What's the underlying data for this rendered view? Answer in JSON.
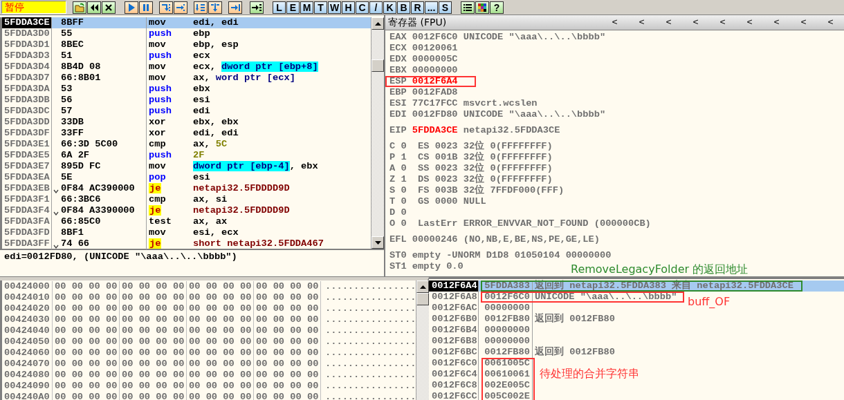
{
  "toolbar": {
    "status": "暂停",
    "letters": [
      "L",
      "E",
      "M",
      "T",
      "W",
      "H",
      "C",
      "/",
      "K",
      "B",
      "R",
      "...",
      "S"
    ],
    "help": "?"
  },
  "disassembly": {
    "rows": [
      {
        "address": "5FDDA3CE",
        "jump_mark": false,
        "bytes": "8BFF",
        "mnemonic": "mov",
        "kind": "plain",
        "selected": true,
        "operands": [
          {
            "text": "edi, edi",
            "kind": "reg"
          }
        ]
      },
      {
        "address": "5FDDA3D0",
        "jump_mark": false,
        "bytes": "55",
        "mnemonic": "push",
        "kind": "stack",
        "selected": false,
        "operands": [
          {
            "text": "ebp",
            "kind": "reg"
          }
        ]
      },
      {
        "address": "5FDDA3D1",
        "jump_mark": false,
        "bytes": "8BEC",
        "mnemonic": "mov",
        "kind": "plain",
        "selected": false,
        "operands": [
          {
            "text": "ebp, esp",
            "kind": "reg"
          }
        ]
      },
      {
        "address": "5FDDA3D3",
        "jump_mark": false,
        "bytes": "51",
        "mnemonic": "push",
        "kind": "stack",
        "selected": false,
        "operands": [
          {
            "text": "ecx",
            "kind": "reg"
          }
        ]
      },
      {
        "address": "5FDDA3D4",
        "jump_mark": false,
        "bytes": "8B4D 08",
        "mnemonic": "mov",
        "kind": "plain",
        "selected": false,
        "operands": [
          {
            "text": "ecx, ",
            "kind": "reg"
          },
          {
            "text": "dword ptr [ebp+8]",
            "kind": "memhl"
          }
        ]
      },
      {
        "address": "5FDDA3D7",
        "jump_mark": false,
        "bytes": "66:8B01",
        "mnemonic": "mov",
        "kind": "plain",
        "selected": false,
        "operands": [
          {
            "text": "ax, ",
            "kind": "reg"
          },
          {
            "text": "word ptr [ecx]",
            "kind": "mem"
          }
        ]
      },
      {
        "address": "5FDDA3DA",
        "jump_mark": false,
        "bytes": "53",
        "mnemonic": "push",
        "kind": "stack",
        "selected": false,
        "operands": [
          {
            "text": "ebx",
            "kind": "reg"
          }
        ]
      },
      {
        "address": "5FDDA3DB",
        "jump_mark": false,
        "bytes": "56",
        "mnemonic": "push",
        "kind": "stack",
        "selected": false,
        "operands": [
          {
            "text": "esi",
            "kind": "reg"
          }
        ]
      },
      {
        "address": "5FDDA3DC",
        "jump_mark": false,
        "bytes": "57",
        "mnemonic": "push",
        "kind": "stack",
        "selected": false,
        "operands": [
          {
            "text": "edi",
            "kind": "reg"
          }
        ]
      },
      {
        "address": "5FDDA3DD",
        "jump_mark": false,
        "bytes": "33DB",
        "mnemonic": "xor",
        "kind": "plain",
        "selected": false,
        "operands": [
          {
            "text": "ebx, ebx",
            "kind": "reg"
          }
        ]
      },
      {
        "address": "5FDDA3DF",
        "jump_mark": false,
        "bytes": "33FF",
        "mnemonic": "xor",
        "kind": "plain",
        "selected": false,
        "operands": [
          {
            "text": "edi, edi",
            "kind": "reg"
          }
        ]
      },
      {
        "address": "5FDDA3E1",
        "jump_mark": false,
        "bytes": "66:3D 5C00",
        "mnemonic": "cmp",
        "kind": "plain",
        "selected": false,
        "operands": [
          {
            "text": "ax, ",
            "kind": "reg"
          },
          {
            "text": "5C",
            "kind": "const"
          }
        ]
      },
      {
        "address": "5FDDA3E5",
        "jump_mark": false,
        "bytes": "6A 2F",
        "mnemonic": "push",
        "kind": "stack",
        "selected": false,
        "operands": [
          {
            "text": "2F",
            "kind": "const"
          }
        ]
      },
      {
        "address": "5FDDA3E7",
        "jump_mark": false,
        "bytes": "895D FC",
        "mnemonic": "mov",
        "kind": "plain",
        "selected": false,
        "operands": [
          {
            "text": "dword ptr [ebp-4]",
            "kind": "memhl"
          },
          {
            "text": ", ebx",
            "kind": "reg"
          }
        ]
      },
      {
        "address": "5FDDA3EA",
        "jump_mark": false,
        "bytes": "5E",
        "mnemonic": "pop",
        "kind": "stack",
        "selected": false,
        "operands": [
          {
            "text": "esi",
            "kind": "reg"
          }
        ]
      },
      {
        "address": "5FDDA3EB",
        "jump_mark": true,
        "bytes": "0F84 AC390000",
        "mnemonic": "je",
        "kind": "jump",
        "selected": false,
        "operands": [
          {
            "text": "netapi32.5FDDDD9D",
            "kind": "target"
          }
        ]
      },
      {
        "address": "5FDDA3F1",
        "jump_mark": false,
        "bytes": "66:3BC6",
        "mnemonic": "cmp",
        "kind": "plain",
        "selected": false,
        "operands": [
          {
            "text": "ax, si",
            "kind": "reg"
          }
        ]
      },
      {
        "address": "5FDDA3F4",
        "jump_mark": true,
        "bytes": "0F84 A3390000",
        "mnemonic": "je",
        "kind": "jump",
        "selected": false,
        "operands": [
          {
            "text": "netapi32.5FDDDD9D",
            "kind": "target"
          }
        ]
      },
      {
        "address": "5FDDA3FA",
        "jump_mark": false,
        "bytes": "66:85C0",
        "mnemonic": "test",
        "kind": "plain",
        "selected": false,
        "operands": [
          {
            "text": "ax, ax",
            "kind": "reg"
          }
        ]
      },
      {
        "address": "5FDDA3FD",
        "jump_mark": false,
        "bytes": "8BF1",
        "mnemonic": "mov",
        "kind": "plain",
        "selected": false,
        "operands": [
          {
            "text": "esi, ecx",
            "kind": "reg"
          }
        ]
      },
      {
        "address": "5FDDA3FF",
        "jump_mark": true,
        "bytes": "74 66",
        "mnemonic": "je",
        "kind": "jump",
        "selected": false,
        "operands": [
          {
            "text": "short netapi32.5FDDA467",
            "kind": "target"
          }
        ]
      }
    ],
    "info": "edi=0012FD80, (UNICODE \"\\aaa\\..\\..\\bbbb\")"
  },
  "registers": {
    "title": "寄存器 (FPU)",
    "arrows": [
      "<",
      "<",
      "<",
      "<",
      "<",
      "<",
      "<",
      "<",
      "<"
    ],
    "groups": [
      [
        {
          "kind": "reg",
          "name": "EAX",
          "value": "0012F6C0",
          "comment": "UNICODE \"\\aaa\\..\\..\\bbbb\"",
          "changed": false
        },
        {
          "kind": "reg",
          "name": "ECX",
          "value": "00120061",
          "changed": false
        },
        {
          "kind": "reg",
          "name": "EDX",
          "value": "0000005C",
          "changed": false
        },
        {
          "kind": "reg",
          "name": "EBX",
          "value": "00000000",
          "changed": false
        },
        {
          "kind": "reg",
          "name": "ESP",
          "value": "0012F6A4",
          "changed": true,
          "box": {
            "color": "#ff3333"
          }
        },
        {
          "kind": "reg",
          "name": "EBP",
          "value": "0012FAD8",
          "changed": false
        },
        {
          "kind": "reg",
          "name": "ESI",
          "value": "77C17FCC",
          "comment": "msvcrt.wcslen",
          "changed": false
        },
        {
          "kind": "reg",
          "name": "EDI",
          "value": "0012FD80",
          "comment": "UNICODE \"\\aaa\\..\\..\\bbbb\"",
          "changed": false
        }
      ],
      [
        {
          "kind": "reg",
          "name": "EIP",
          "value": "5FDDA3CE",
          "comment": "netapi32.5FDDA3CE",
          "changed": true
        }
      ],
      [
        {
          "kind": "text",
          "text": "C 0  ES 0023 32位 0(FFFFFFFF)"
        },
        {
          "kind": "text",
          "text": "P 1  CS 001B 32位 0(FFFFFFFF)"
        },
        {
          "kind": "text",
          "text": "A 0  SS 0023 32位 0(FFFFFFFF)"
        },
        {
          "kind": "text",
          "text": "Z 1  DS 0023 32位 0(FFFFFFFF)"
        },
        {
          "kind": "text",
          "text": "S 0  FS 003B 32位 7FFDF000(FFF)"
        },
        {
          "kind": "text",
          "text": "T 0  GS 0000 NULL"
        },
        {
          "kind": "text",
          "text": "D 0"
        },
        {
          "kind": "text",
          "text": "O 0  LastErr ERROR_ENVVAR_NOT_FOUND (000000CB)"
        }
      ],
      [
        {
          "kind": "text",
          "text": "EFL 00000246 (NO,NB,E,BE,NS,PE,GE,LE)"
        }
      ],
      [
        {
          "kind": "text",
          "text": "ST0 empty -UNORM D1D8 01050104 00000000"
        },
        {
          "kind": "text",
          "text": "ST1 empty 0.0"
        }
      ]
    ]
  },
  "dump": {
    "rows": [
      {
        "address": "00424000",
        "hex": [
          "00 00 00 00",
          "00 00 00 00",
          "00 00 00 00",
          "00 00 00 00"
        ],
        "ascii": "................"
      },
      {
        "address": "00424010",
        "hex": [
          "00 00 00 00",
          "00 00 00 00",
          "00 00 00 00",
          "00 00 00 00"
        ],
        "ascii": "................"
      },
      {
        "address": "00424020",
        "hex": [
          "00 00 00 00",
          "00 00 00 00",
          "00 00 00 00",
          "00 00 00 00"
        ],
        "ascii": "................"
      },
      {
        "address": "00424030",
        "hex": [
          "00 00 00 00",
          "00 00 00 00",
          "00 00 00 00",
          "00 00 00 00"
        ],
        "ascii": "................"
      },
      {
        "address": "00424040",
        "hex": [
          "00 00 00 00",
          "00 00 00 00",
          "00 00 00 00",
          "00 00 00 00"
        ],
        "ascii": "................"
      },
      {
        "address": "00424050",
        "hex": [
          "00 00 00 00",
          "00 00 00 00",
          "00 00 00 00",
          "00 00 00 00"
        ],
        "ascii": "................"
      },
      {
        "address": "00424060",
        "hex": [
          "00 00 00 00",
          "00 00 00 00",
          "00 00 00 00",
          "00 00 00 00"
        ],
        "ascii": "................"
      },
      {
        "address": "00424070",
        "hex": [
          "00 00 00 00",
          "00 00 00 00",
          "00 00 00 00",
          "00 00 00 00"
        ],
        "ascii": "................"
      },
      {
        "address": "00424080",
        "hex": [
          "00 00 00 00",
          "00 00 00 00",
          "00 00 00 00",
          "00 00 00 00"
        ],
        "ascii": "................"
      },
      {
        "address": "00424090",
        "hex": [
          "00 00 00 00",
          "00 00 00 00",
          "00 00 00 00",
          "00 00 00 00"
        ],
        "ascii": "................"
      },
      {
        "address": "004240A0",
        "hex": [
          "00 00 00 00",
          "00 00 00 00",
          "00 00 00 00",
          "00 00 00 00"
        ],
        "ascii": "................"
      }
    ]
  },
  "stack": {
    "rows": [
      {
        "address": "0012F6A4",
        "value": "5FDDA383",
        "comment": "返回到 netapi32.5FDDA383 来自 netapi32.5FDDA3CE",
        "selected": true,
        "box": {
          "color": "#2e8b2e"
        }
      },
      {
        "address": "0012F6A8",
        "value": "0012F6C0",
        "comment": "UNICODE \"\\aaa\\..\\..\\bbbb\"",
        "selected": false,
        "box": {
          "color": "#ff3333"
        }
      },
      {
        "address": "0012F6AC",
        "value": "00000000",
        "selected": false
      },
      {
        "address": "0012F6B0",
        "value": "0012FB80",
        "comment": "返回到 0012FB80",
        "selected": false
      },
      {
        "address": "0012F6B4",
        "value": "00000000",
        "selected": false
      },
      {
        "address": "0012F6B8",
        "value": "00000000",
        "selected": false
      },
      {
        "address": "0012F6BC",
        "value": "0012FB80",
        "comment": "返回到 0012FB80",
        "selected": false
      },
      {
        "address": "0012F6C0",
        "value": "0061005C",
        "selected": false,
        "box": {
          "color": "#ff3333",
          "value_only": true
        }
      },
      {
        "address": "0012F6C4",
        "value": "00610061",
        "selected": false,
        "box": {
          "color": "#ff3333",
          "value_only": true
        }
      },
      {
        "address": "0012F6C8",
        "value": "002E005C",
        "selected": false,
        "box": {
          "color": "#ff3333",
          "value_only": true
        }
      },
      {
        "address": "0012F6CC",
        "value": "005C002E",
        "selected": false,
        "box": {
          "color": "#ff3333",
          "value_only": true
        }
      }
    ]
  },
  "annotations": [
    {
      "text": "RemoveLegacyFolder 的返回地址",
      "color": "#2e8b2e"
    },
    {
      "text": "buff_OF",
      "color": "#ff3333"
    },
    {
      "text": "待处理的合并字符串",
      "color": "#ff3333"
    }
  ]
}
